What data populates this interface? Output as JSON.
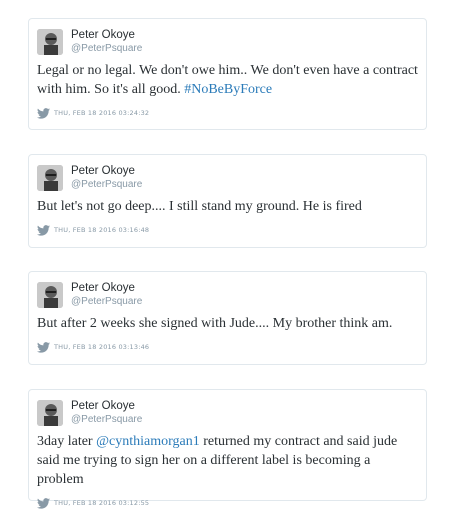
{
  "tweets": [
    {
      "name": "Peter Okoye",
      "handle": "@PeterPsquare",
      "text_parts": [
        "Legal or no legal. We don't owe him.. We don't even have a contract with him. So it's all good. ",
        "#NoBeByForce"
      ],
      "timestamp": "THU, FEB 18 2016 03:24:32"
    },
    {
      "name": "Peter Okoye",
      "handle": "@PeterPsquare",
      "text": "But let's not go deep.... I still stand my ground. He is fired",
      "timestamp": "THU, FEB 18 2016 03:16:48"
    },
    {
      "name": "Peter Okoye",
      "handle": "@PeterPsquare",
      "text": "But after 2 weeks she signed with Jude.... My brother think am.",
      "timestamp": "THU, FEB 18 2016 03:13:46"
    },
    {
      "name": "Peter Okoye",
      "handle": "@PeterPsquare",
      "text_parts": [
        "3day later ",
        "@cynthiamorgan1",
        " returned my contract and said jude said me trying to sign her on a different label is becoming a problem"
      ],
      "timestamp": "THU, FEB 18 2016 03:12:55"
    }
  ],
  "icons": {
    "avatar": "profile-photo",
    "bird": "twitter-bird-icon"
  },
  "colors": {
    "link": "#2b7bb9",
    "border": "#e1e8ed",
    "muted": "#8899a6",
    "text": "#292f33"
  }
}
